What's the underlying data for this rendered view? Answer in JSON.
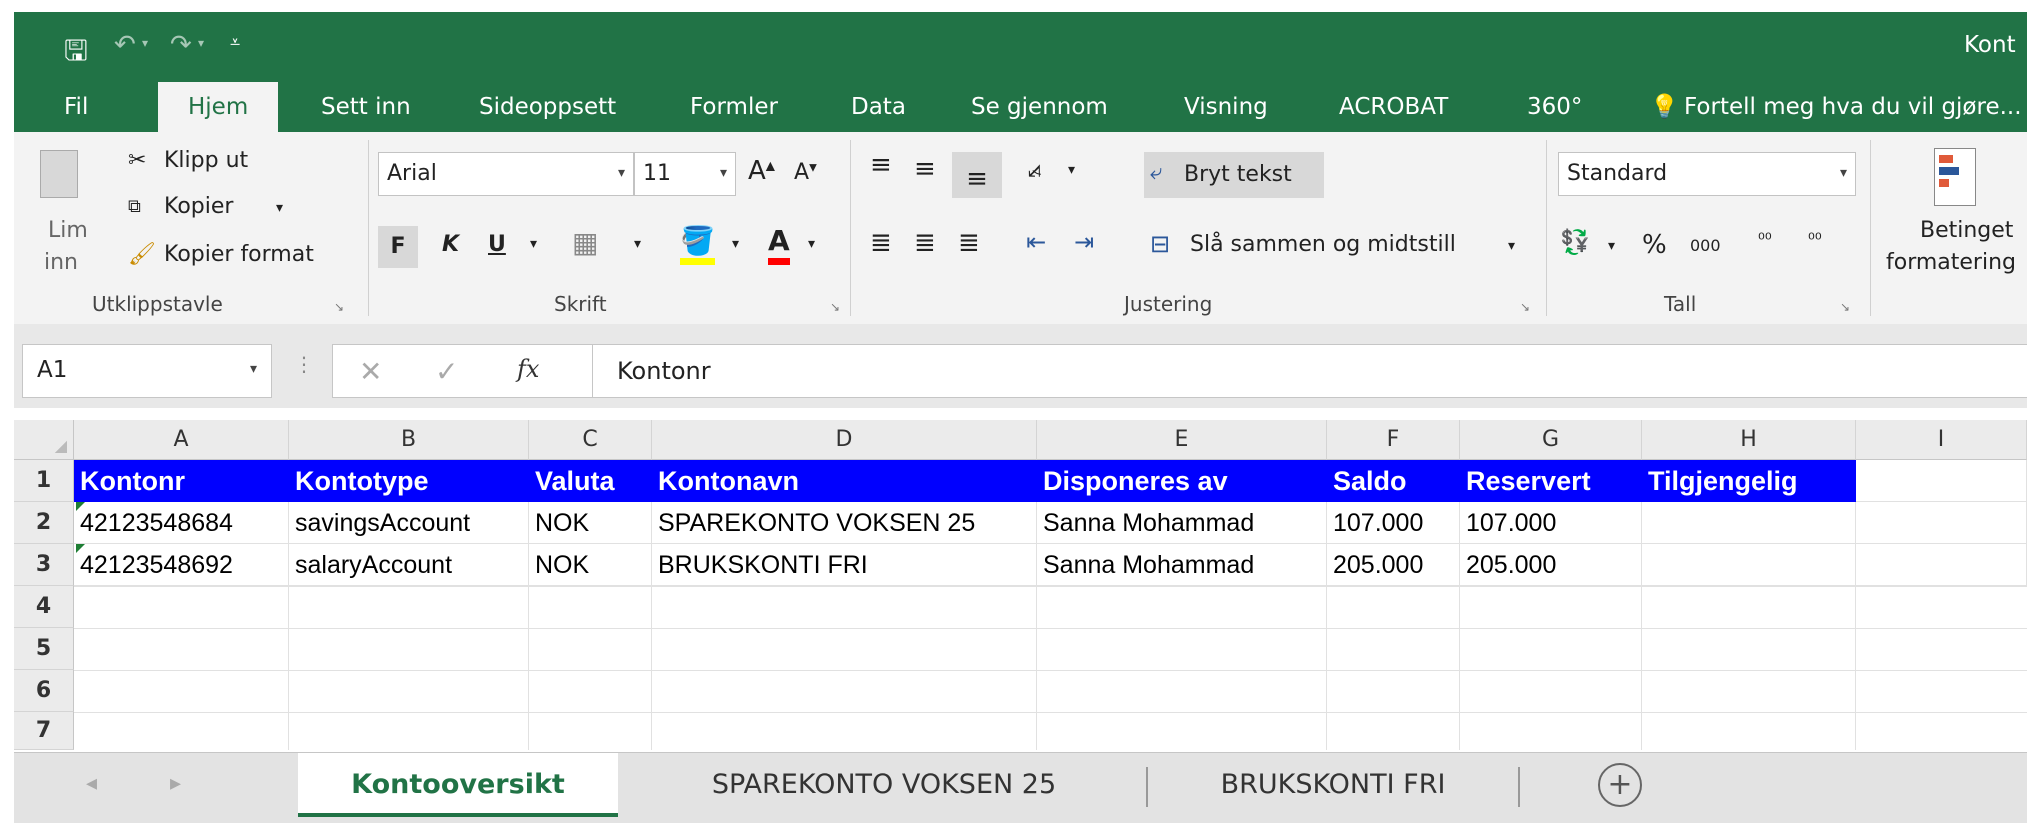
{
  "title_bar": {
    "title_fragment": "Kont"
  },
  "tabs": [
    "Fil",
    "Hjem",
    "Sett inn",
    "Sideoppsett",
    "Formler",
    "Data",
    "Se gjennom",
    "Visning",
    "ACROBAT",
    "360°"
  ],
  "tell_me": "Fortell meg hva du vil gjøre...",
  "clipboard": {
    "paste": "Lim",
    "paste2": "inn",
    "cut": "Klipp ut",
    "copy": "Kopier",
    "format_painter": "Kopier format",
    "label": "Utklippstavle"
  },
  "font": {
    "name": "Arial",
    "size": "11",
    "bold": "F",
    "italic": "K",
    "underline": "U",
    "label": "Skrift"
  },
  "alignment": {
    "wrap": "Bryt tekst",
    "merge": "Slå sammen og midtstill",
    "label": "Justering"
  },
  "number": {
    "format": "Standard",
    "percent": "%",
    "thousands": "000",
    "label": "Tall"
  },
  "styles": {
    "conditional1": "Betinget",
    "conditional2": "formatering"
  },
  "formula_bar": {
    "name_box": "A1",
    "fx": "fx",
    "value": "Kontonr"
  },
  "columns": [
    "A",
    "B",
    "C",
    "D",
    "E",
    "F",
    "G",
    "H",
    "I"
  ],
  "rows": [
    "1",
    "2",
    "3",
    "4",
    "5",
    "6",
    "7"
  ],
  "table": {
    "header": [
      "Kontonr",
      "Kontotype",
      "Valuta",
      "Kontonavn",
      "Disponeres av",
      "Saldo",
      "Reservert",
      "Tilgjengelig"
    ],
    "row2": [
      "42123548684",
      "savingsAccount",
      "NOK",
      "SPAREKONTO VOKSEN 25",
      "Sanna Mohammad",
      "107.000",
      "107.000",
      ""
    ],
    "row3": [
      "42123548692",
      "salaryAccount",
      "NOK",
      "BRUKSKONTI FRI",
      "Sanna Mohammad",
      "205.000",
      "205.000",
      ""
    ]
  },
  "sheets": [
    "Kontooversikt",
    "SPAREKONTO VOKSEN 25",
    "BRUKSKONTI FRI"
  ],
  "colors": {
    "excel_green": "#217346",
    "header_fill": "#0000ff"
  }
}
